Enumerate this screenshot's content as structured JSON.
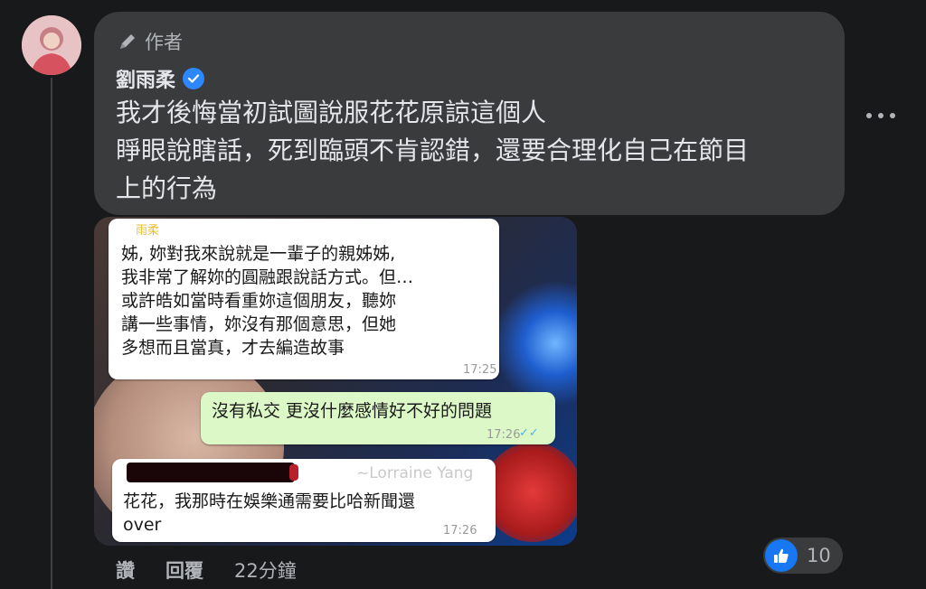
{
  "comment": {
    "author_badge": "作者",
    "author_name": "劉雨柔",
    "text_lines": [
      "我才後悔當初試圖說服花花原諒這個人",
      "睜眼說瞎話，死到臨頭不肯認錯，還要合理化自己在節目",
      "上的行為"
    ],
    "more_label": "更多選項"
  },
  "screenshot": {
    "msg1": {
      "sender": "雨柔",
      "lines": [
        "姊, 妳對我來說就是一輩子的親姊姊,",
        "我非常了解妳的圓融跟說話方式。但…",
        "或許皓如當時看重妳這個朋友，聽妳",
        "講一些事情，妳沒有那個意思，但她",
        "多想而且當真，才去編造故事"
      ],
      "time": "17:25"
    },
    "msg2": {
      "text": "沒有私交 更沒什麼感情好不好的問題",
      "time": "17:26",
      "status": "✓✓"
    },
    "msg3": {
      "sender": "~Lorraine Yang",
      "lines": [
        "花花，我那時在娛樂通需要比哈新聞還",
        "over"
      ],
      "time": "17:26"
    }
  },
  "actions": {
    "like": "讚",
    "reply": "回覆",
    "timestamp": "22分鐘"
  },
  "reactions": {
    "icon": "thumbs-up-icon",
    "count": "10"
  }
}
